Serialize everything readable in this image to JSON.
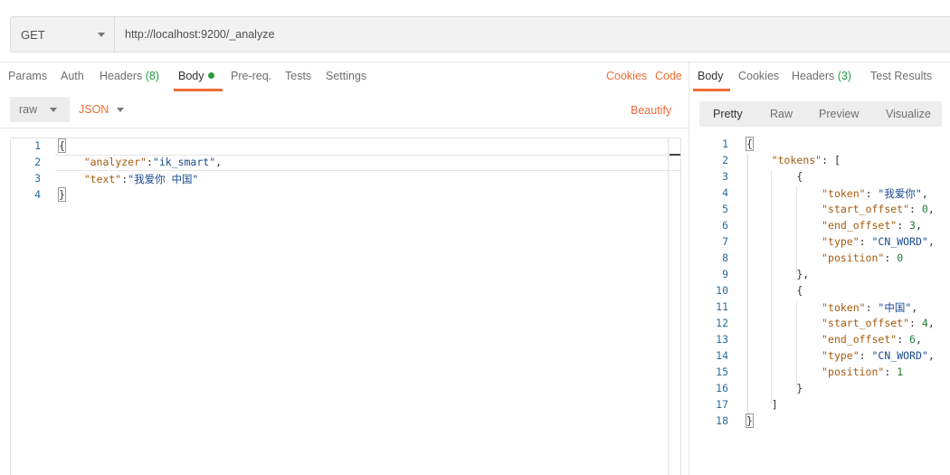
{
  "request": {
    "method": "GET",
    "url": "http://localhost:9200/_analyze"
  },
  "request_tabs": [
    {
      "label": "Params"
    },
    {
      "label": "Auth"
    },
    {
      "label": "Headers ",
      "count": "(8)"
    },
    {
      "label": "Body"
    },
    {
      "label": "Pre-req."
    },
    {
      "label": "Tests"
    },
    {
      "label": "Settings"
    }
  ],
  "request_links": {
    "cookies": "Cookies",
    "code": "Code"
  },
  "body_mode": {
    "type": "raw",
    "format": "JSON",
    "beautify": "Beautify"
  },
  "request_body": {
    "line_numbers": [
      "1",
      "2",
      "3",
      "4"
    ],
    "lines": [
      [
        {
          "t": "{",
          "c": "p"
        }
      ],
      [
        {
          "t": "    ",
          "c": "p"
        },
        {
          "t": "\"analyzer\"",
          "c": "k"
        },
        {
          "t": ":",
          "c": "p"
        },
        {
          "t": "\"ik_smart\"",
          "c": "s"
        },
        {
          "t": ",",
          "c": "p"
        }
      ],
      [
        {
          "t": "    ",
          "c": "p"
        },
        {
          "t": "\"text\"",
          "c": "k"
        },
        {
          "t": ":",
          "c": "p"
        },
        {
          "t": "\"我爱你 中国\"",
          "c": "s"
        }
      ],
      [
        {
          "t": "}",
          "c": "p"
        }
      ]
    ]
  },
  "response_tabs": [
    {
      "label": "Body"
    },
    {
      "label": "Cookies"
    },
    {
      "label": "Headers ",
      "count": "(3)"
    },
    {
      "label": "Test Results"
    }
  ],
  "response_view_tabs": [
    "Pretty",
    "Raw",
    "Preview",
    "Visualize"
  ],
  "response_body": {
    "line_numbers": [
      "1",
      "2",
      "3",
      "4",
      "5",
      "6",
      "7",
      "8",
      "9",
      "10",
      "11",
      "12",
      "13",
      "14",
      "15",
      "16",
      "17",
      "18"
    ],
    "lines": [
      [
        {
          "t": "{",
          "c": "p"
        }
      ],
      [
        {
          "t": "    ",
          "c": "p"
        },
        {
          "t": "\"tokens\"",
          "c": "k"
        },
        {
          "t": ": [",
          "c": "p"
        }
      ],
      [
        {
          "t": "        {",
          "c": "p"
        }
      ],
      [
        {
          "t": "            ",
          "c": "p"
        },
        {
          "t": "\"token\"",
          "c": "k"
        },
        {
          "t": ": ",
          "c": "p"
        },
        {
          "t": "\"我爱你\"",
          "c": "s"
        },
        {
          "t": ",",
          "c": "p"
        }
      ],
      [
        {
          "t": "            ",
          "c": "p"
        },
        {
          "t": "\"start_offset\"",
          "c": "k"
        },
        {
          "t": ": ",
          "c": "p"
        },
        {
          "t": "0",
          "c": "n"
        },
        {
          "t": ",",
          "c": "p"
        }
      ],
      [
        {
          "t": "            ",
          "c": "p"
        },
        {
          "t": "\"end_offset\"",
          "c": "k"
        },
        {
          "t": ": ",
          "c": "p"
        },
        {
          "t": "3",
          "c": "n"
        },
        {
          "t": ",",
          "c": "p"
        }
      ],
      [
        {
          "t": "            ",
          "c": "p"
        },
        {
          "t": "\"type\"",
          "c": "k"
        },
        {
          "t": ": ",
          "c": "p"
        },
        {
          "t": "\"CN_WORD\"",
          "c": "s"
        },
        {
          "t": ",",
          "c": "p"
        }
      ],
      [
        {
          "t": "            ",
          "c": "p"
        },
        {
          "t": "\"position\"",
          "c": "k"
        },
        {
          "t": ": ",
          "c": "p"
        },
        {
          "t": "0",
          "c": "n"
        }
      ],
      [
        {
          "t": "        },",
          "c": "p"
        }
      ],
      [
        {
          "t": "        {",
          "c": "p"
        }
      ],
      [
        {
          "t": "            ",
          "c": "p"
        },
        {
          "t": "\"token\"",
          "c": "k"
        },
        {
          "t": ": ",
          "c": "p"
        },
        {
          "t": "\"中国\"",
          "c": "s"
        },
        {
          "t": ",",
          "c": "p"
        }
      ],
      [
        {
          "t": "            ",
          "c": "p"
        },
        {
          "t": "\"start_offset\"",
          "c": "k"
        },
        {
          "t": ": ",
          "c": "p"
        },
        {
          "t": "4",
          "c": "n"
        },
        {
          "t": ",",
          "c": "p"
        }
      ],
      [
        {
          "t": "            ",
          "c": "p"
        },
        {
          "t": "\"end_offset\"",
          "c": "k"
        },
        {
          "t": ": ",
          "c": "p"
        },
        {
          "t": "6",
          "c": "n"
        },
        {
          "t": ",",
          "c": "p"
        }
      ],
      [
        {
          "t": "            ",
          "c": "p"
        },
        {
          "t": "\"type\"",
          "c": "k"
        },
        {
          "t": ": ",
          "c": "p"
        },
        {
          "t": "\"CN_WORD\"",
          "c": "s"
        },
        {
          "t": ",",
          "c": "p"
        }
      ],
      [
        {
          "t": "            ",
          "c": "p"
        },
        {
          "t": "\"position\"",
          "c": "k"
        },
        {
          "t": ": ",
          "c": "p"
        },
        {
          "t": "1",
          "c": "n"
        }
      ],
      [
        {
          "t": "        }",
          "c": "p"
        }
      ],
      [
        {
          "t": "    ]",
          "c": "p"
        }
      ],
      [
        {
          "t": "}",
          "c": "p"
        }
      ]
    ]
  },
  "colors": {
    "accent": "#ef6c34",
    "count_green": "#21a03c",
    "body_dot": "#2b9c3c"
  }
}
